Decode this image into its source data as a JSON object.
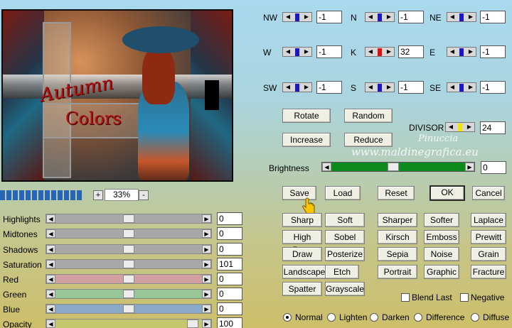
{
  "preview": {
    "title_word1": "Autumn",
    "title_word2": "Colors"
  },
  "zoom": {
    "value": "33%",
    "plus": "+",
    "minus": "-",
    "progress_segments": 13
  },
  "sliders": [
    {
      "label": "Highlights",
      "value": "0"
    },
    {
      "label": "Midtones",
      "value": "0"
    },
    {
      "label": "Shadows",
      "value": "0"
    },
    {
      "label": "Saturation",
      "value": "101"
    },
    {
      "label": "Red",
      "value": "0"
    },
    {
      "label": "Green",
      "value": "0"
    },
    {
      "label": "Blue",
      "value": "0"
    },
    {
      "label": "Opacity",
      "value": "100"
    }
  ],
  "slider_colors": {
    "Red": "#d2a0a0",
    "Green": "#98c698",
    "Blue": "#8aa8c8",
    "Opacity": "#c6c66e"
  },
  "kernel": {
    "NW": {
      "label": "NW",
      "value": "-1"
    },
    "N": {
      "label": "N",
      "value": "-1"
    },
    "NE": {
      "label": "NE",
      "value": "-1"
    },
    "W": {
      "label": "W",
      "value": "-1"
    },
    "K": {
      "label": "K",
      "value": "32"
    },
    "E": {
      "label": "E",
      "value": "-1"
    },
    "SW": {
      "label": "SW",
      "value": "-1"
    },
    "S": {
      "label": "S",
      "value": "-1"
    },
    "SE": {
      "label": "SE",
      "value": "-1"
    }
  },
  "kernel_buttons": {
    "rotate": "Rotate",
    "random": "Random",
    "increase": "Increase",
    "reduce": "Reduce"
  },
  "divisor": {
    "label": "DIVISOR",
    "value": "24"
  },
  "brightness": {
    "label": "Brightness",
    "value": "0"
  },
  "actions": {
    "save": "Save",
    "load": "Load",
    "reset": "Reset",
    "ok": "OK",
    "cancel": "Cancel"
  },
  "presets": [
    [
      "Sharp",
      "Soft",
      "Sharper",
      "Softer",
      "Laplace"
    ],
    [
      "High Pass",
      "Sobel",
      "Kirsch",
      "Emboss",
      "Prewitt"
    ],
    [
      "Draw",
      "Posterize",
      "Sepia",
      "Noise",
      "Grain"
    ],
    [
      "Landscape",
      "Etch",
      "Portrait",
      "Graphic",
      "Fracture"
    ],
    [
      "Spatter",
      "Grayscale"
    ]
  ],
  "options": {
    "blend_last": "Blend Last",
    "negative": "Negative"
  },
  "blend_modes": [
    {
      "label": "Normal",
      "selected": true
    },
    {
      "label": "Lighten",
      "selected": false
    },
    {
      "label": "Darken",
      "selected": false
    },
    {
      "label": "Difference",
      "selected": false
    },
    {
      "label": "Diffuse",
      "selected": false
    }
  ],
  "watermark": {
    "line1": "Pinuccia",
    "line2": "www.maldinegrafica.eu"
  },
  "colors": {
    "kernel_indicator": "#1a17c9",
    "kernel_center_indicator": "#e01010",
    "divisor_indicator": "#f2e600",
    "brightness_track": "#0c8a1b",
    "zoom_progress": "#2566b8"
  }
}
